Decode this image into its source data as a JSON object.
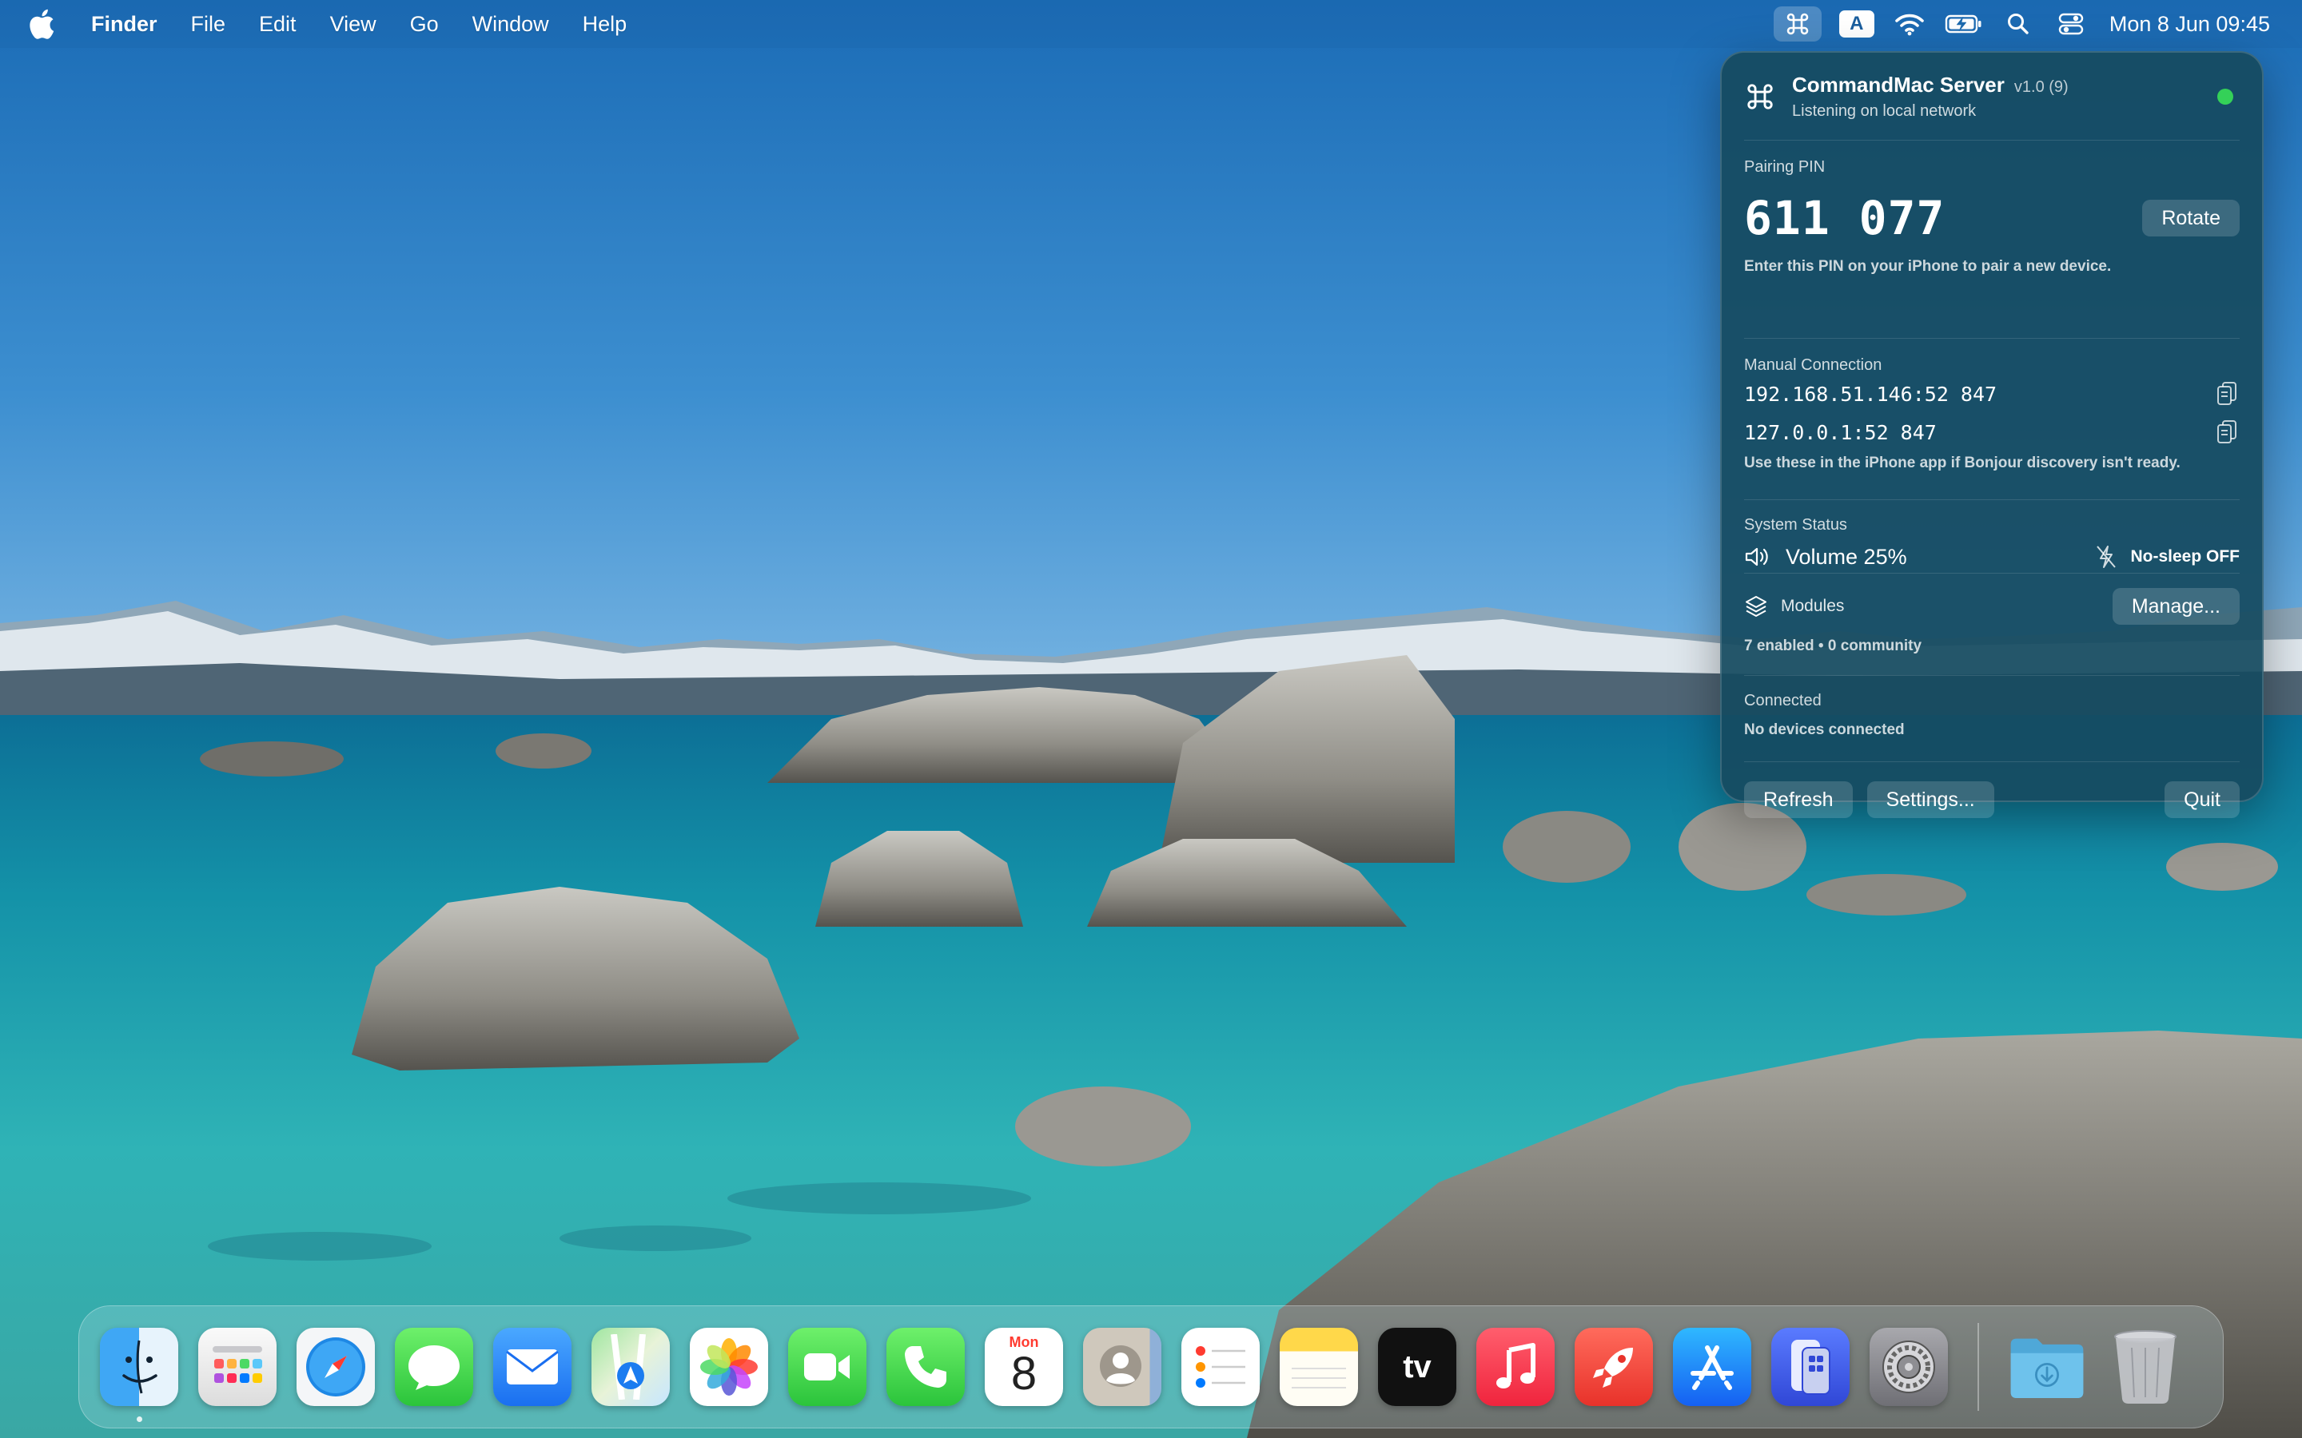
{
  "menubar": {
    "app_name": "Finder",
    "menus": [
      "File",
      "Edit",
      "View",
      "Go",
      "Window",
      "Help"
    ],
    "input_source": "A",
    "clock": "Mon 8 Jun  09:45"
  },
  "popover": {
    "title": "CommandMac Server",
    "version": "v1.0 (9)",
    "subtitle": "Listening on local network",
    "status_color": "#34d158",
    "pairing": {
      "label": "Pairing PIN",
      "pin": "611 077",
      "rotate_label": "Rotate",
      "hint": "Enter this PIN on your iPhone to pair a new device."
    },
    "manual_connection": {
      "label": "Manual Connection",
      "addresses": [
        "192.168.51.146:52 847",
        "127.0.0.1:52 847"
      ],
      "hint": "Use these in the iPhone app if Bonjour discovery isn't ready."
    },
    "system_status": {
      "label": "System Status",
      "volume": "Volume 25%",
      "no_sleep": "No-sleep OFF"
    },
    "modules": {
      "label": "Modules",
      "manage_label": "Manage...",
      "summary": "7 enabled • 0 community"
    },
    "connected": {
      "label": "Connected",
      "status": "No devices connected"
    },
    "footer": {
      "refresh_label": "Refresh",
      "settings_label": "Settings...",
      "quit_label": "Quit"
    }
  },
  "dock": {
    "calendar_day": "Mon",
    "calendar_date": "8",
    "tv_label": "tv",
    "apps": [
      "finder",
      "launchpad",
      "safari",
      "messages",
      "mail",
      "maps",
      "photos",
      "facetime",
      "phone",
      "calendar",
      "contacts",
      "reminders",
      "notes",
      "tv",
      "music",
      "rocket",
      "app-store",
      "iphone-mirroring",
      "system-settings"
    ]
  }
}
